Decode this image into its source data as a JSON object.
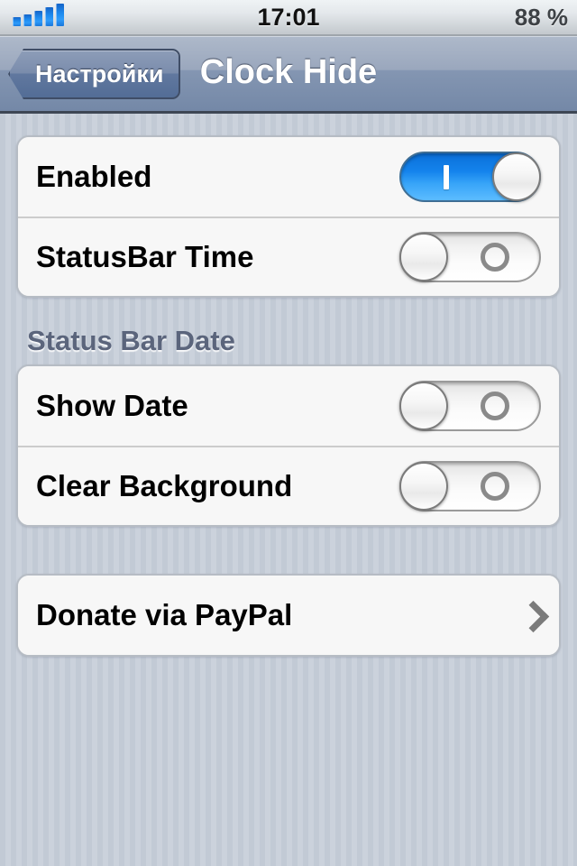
{
  "status_bar": {
    "signal_icon": "signal-bars-icon",
    "signal_bars_total": 5,
    "time": "17:01",
    "battery": "88 %"
  },
  "nav_bar": {
    "back_label": "Настройки",
    "back_icon": "chevron-left-icon",
    "title": "Clock Hide"
  },
  "sections": [
    {
      "header": null,
      "rows": [
        {
          "label": "Enabled",
          "control": "switch",
          "value": "on"
        },
        {
          "label": "StatusBar Time",
          "control": "switch",
          "value": "off"
        }
      ]
    },
    {
      "header": "Status Bar Date",
      "rows": [
        {
          "label": "Show Date",
          "control": "switch",
          "value": "off"
        },
        {
          "label": "Clear Background",
          "control": "switch",
          "value": "off"
        }
      ]
    },
    {
      "header": null,
      "rows": [
        {
          "label": "Donate via PayPal",
          "control": "disclosure",
          "icon": "chevron-right-icon"
        }
      ]
    }
  ],
  "colors": {
    "accent_on": "#1483ec",
    "nav_bar": "#8496b2",
    "wallpaper": "#c3cbd6",
    "cell_bg": "#f7f7f7",
    "header_text": "#5b657c",
    "chevron": "#7b7b7b"
  }
}
